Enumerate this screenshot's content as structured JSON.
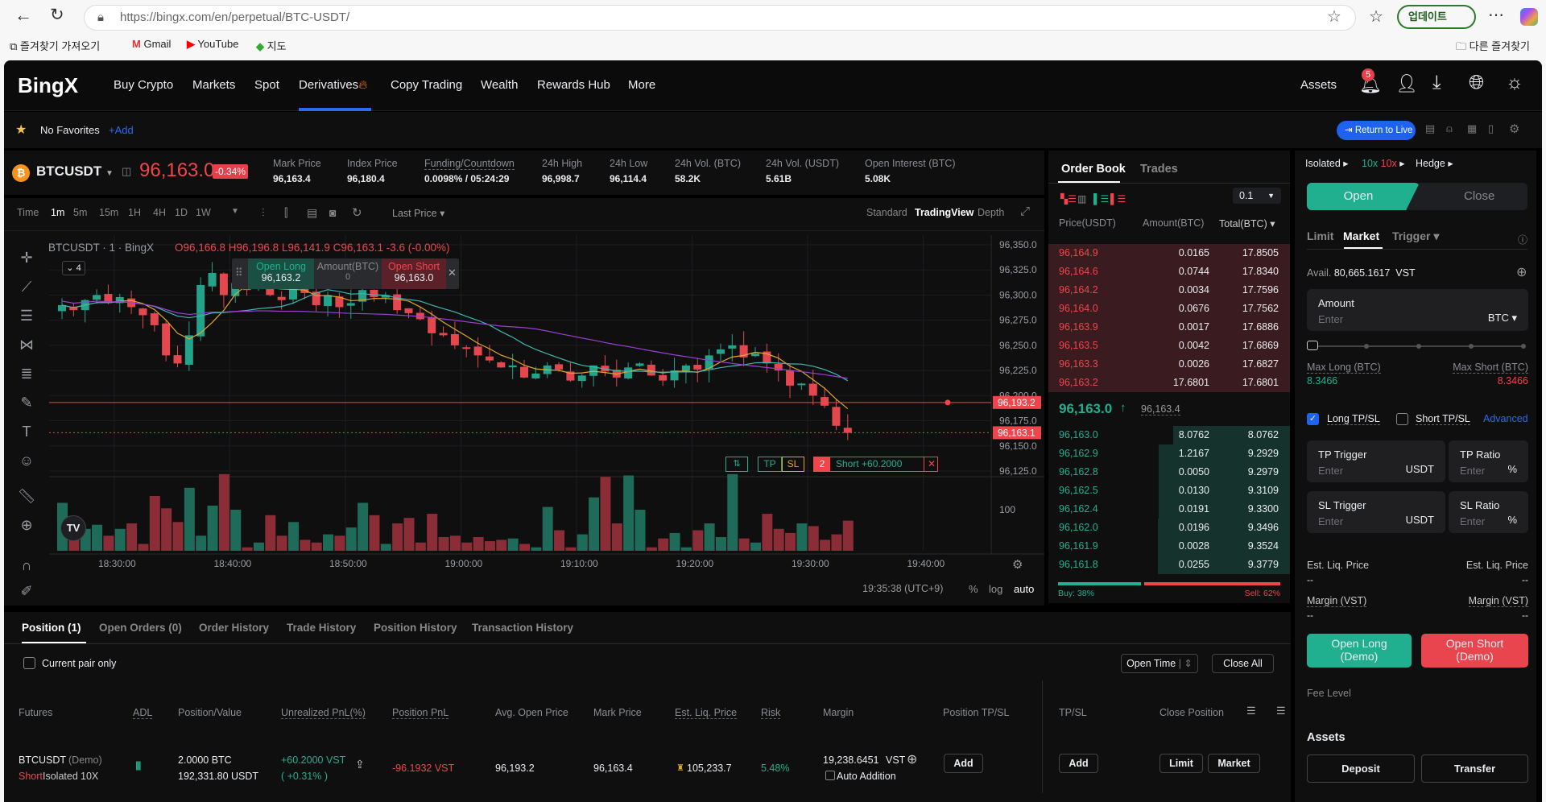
{
  "browser": {
    "url": "https://bingx.com/en/perpetual/BTC-USDT/",
    "update_label": "업데이트",
    "bookmarks": [
      "즐겨찾기 가져오기",
      "Gmail",
      "YouTube",
      "지도"
    ],
    "other_bookmarks": "다른 즐겨찾기"
  },
  "nav": {
    "logo": "BingX",
    "items": [
      "Buy Crypto",
      "Markets",
      "Spot",
      "Derivatives",
      "Copy Trading",
      "Wealth",
      "Rewards Hub",
      "More"
    ],
    "assets": "Assets",
    "notif_count": "5"
  },
  "favorites": {
    "label": "No Favorites",
    "add": "+Add",
    "return_live": "Return to Live"
  },
  "ticker": {
    "symbol": "BTCUSDT",
    "price": "96,163.0",
    "change": "-0.34%",
    "stats": [
      {
        "label": "Mark Price",
        "value": "96,163.4"
      },
      {
        "label": "Index Price",
        "value": "96,180.4"
      },
      {
        "label": "Funding/Countdown",
        "value": "0.0098% / 05:24:29"
      },
      {
        "label": "24h High",
        "value": "96,998.7"
      },
      {
        "label": "24h Low",
        "value": "96,114.4"
      },
      {
        "label": "24h Vol. (BTC)",
        "value": "58.2K"
      },
      {
        "label": "24h Vol. (USDT)",
        "value": "5.61B"
      },
      {
        "label": "Open Interest (BTC)",
        "value": "5.08K"
      }
    ]
  },
  "chart_toolbar": {
    "intervals": [
      "Time",
      "1m",
      "5m",
      "15m",
      "1H",
      "4H",
      "1D",
      "1W"
    ],
    "price_type": "Last Price",
    "views": [
      "Standard",
      "TradingView",
      "Depth"
    ]
  },
  "chart": {
    "legend_symbol": "BTCUSDT · 1 · BingX",
    "ohlc": "O96,166.8 H96,196.8 L96,141.9 C96,163.1 -3.6 (-0.00%)",
    "indicators_count": "4",
    "quick": {
      "open_long": "Open Long",
      "long_price": "96,163.2",
      "amount": "Amount(BTC)",
      "amount_val": "0",
      "open_short": "Open Short",
      "short_price": "96,163.0"
    },
    "position_line": {
      "tp": "TP",
      "sl": "SL",
      "qty": "2",
      "label": "Short +60.2000",
      "price": "96,193.2",
      "value": 96193.2
    },
    "last_price": {
      "label": "96,163.1",
      "value": 96163.1
    },
    "price_ticks": [
      "96,350.0",
      "96,325.0",
      "96,300.0",
      "96,275.0",
      "96,250.0",
      "96,225.0",
      "96,200.0",
      "96,175.0",
      "96,150.0",
      "96,125.0"
    ],
    "price_range": [
      96125,
      96350
    ],
    "time_ticks": [
      "18:30:00",
      "18:40:00",
      "18:50:00",
      "19:00:00",
      "19:10:00",
      "19:20:00",
      "19:30:00",
      "19:40:00"
    ],
    "volume_tick": "100",
    "closes": [
      96290,
      96285,
      96295,
      96300,
      96292,
      96298,
      96288,
      96280,
      96270,
      96240,
      96232,
      96260,
      96310,
      96322,
      96300,
      96312,
      96305,
      96318,
      96300,
      96295,
      96310,
      96302,
      96290,
      96300,
      96288,
      96292,
      96305,
      96298,
      96300,
      96285,
      96282,
      96276,
      96262,
      96260,
      96250,
      96248,
      96240,
      96235,
      96228,
      96230,
      96218,
      96222,
      96230,
      96226,
      96215,
      96220,
      96230,
      96224,
      96218,
      96228,
      96232,
      96220,
      96215,
      96225,
      96230,
      96226,
      96240,
      96246,
      96250,
      96238,
      96242,
      96232,
      96225,
      96210,
      96212,
      96200,
      96190,
      96170,
      96163
    ],
    "volumes": [
      70,
      22,
      32,
      38,
      22,
      32,
      40,
      10,
      80,
      62,
      42,
      92,
      22,
      66,
      112,
      60,
      5,
      12,
      52,
      22,
      42,
      16,
      12,
      24,
      22,
      34,
      70,
      52,
      10,
      40,
      48,
      12,
      54,
      20,
      22,
      12,
      20,
      14,
      16,
      18,
      10,
      5,
      64,
      30,
      5,
      24,
      78,
      108,
      40,
      110,
      60,
      5,
      18,
      26,
      5,
      30,
      40,
      20,
      112,
      18,
      12,
      54,
      32,
      26,
      40,
      36,
      16,
      24,
      44
    ],
    "timestamp": "19:35:38 (UTC+9)",
    "scale_opts": [
      "%",
      "log",
      "auto"
    ]
  },
  "orderbook": {
    "tabs": [
      "Order Book",
      "Trades"
    ],
    "precision": "0.1",
    "headers": [
      "Price(USDT)",
      "Amount(BTC)",
      "Total(BTC)"
    ],
    "asks": [
      [
        "96,164.9",
        "0.0165",
        "17.8505"
      ],
      [
        "96,164.6",
        "0.0744",
        "17.8340"
      ],
      [
        "96,164.2",
        "0.0034",
        "17.7596"
      ],
      [
        "96,164.0",
        "0.0676",
        "17.7562"
      ],
      [
        "96,163.9",
        "0.0017",
        "17.6886"
      ],
      [
        "96,163.5",
        "0.0042",
        "17.6869"
      ],
      [
        "96,163.3",
        "0.0026",
        "17.6827"
      ],
      [
        "96,163.2",
        "17.6801",
        "17.6801"
      ]
    ],
    "mid_price": "96,163.0",
    "mark": "96,163.4",
    "bids": [
      [
        "96,163.0",
        "8.0762",
        "8.0762"
      ],
      [
        "96,162.9",
        "1.2167",
        "9.2929"
      ],
      [
        "96,162.8",
        "0.0050",
        "9.2979"
      ],
      [
        "96,162.5",
        "0.0130",
        "9.3109"
      ],
      [
        "96,162.4",
        "0.0191",
        "9.3300"
      ],
      [
        "96,162.0",
        "0.0196",
        "9.3496"
      ],
      [
        "96,161.9",
        "0.0028",
        "9.3524"
      ],
      [
        "96,161.8",
        "0.0255",
        "9.3779"
      ]
    ],
    "buy_pct": 38,
    "buy_label": "Buy: 38%",
    "sell_label": "Sell: 62%"
  },
  "order": {
    "margin_mode": "Isolated",
    "lev_long": "10x",
    "lev_short": "10x",
    "mode": "Hedge",
    "open": "Open",
    "close": "Close",
    "types": [
      "Limit",
      "Market",
      "Trigger"
    ],
    "avail_label": "Avail.",
    "avail": "80,665.1617",
    "avail_unit": "VST",
    "amount_label": "Amount",
    "placeholder": "Enter",
    "amount_unit": "BTC",
    "max_long_label": "Max Long (BTC)",
    "max_long": "8.3466",
    "max_short_label": "Max Short (BTC)",
    "max_short": "8.3466",
    "long_tpsl": "Long TP/SL",
    "short_tpsl": "Short TP/SL",
    "advanced": "Advanced",
    "tp_trigger": "TP Trigger",
    "tp_ratio": "TP Ratio",
    "sl_trigger": "SL Trigger",
    "sl_ratio": "SL Ratio",
    "usdt": "USDT",
    "pct": "%",
    "est_liq": "Est. Liq. Price",
    "margin_vst": "Margin (VST)",
    "dash": "--",
    "open_long": "Open Long",
    "open_short": "Open Short",
    "demo": "(Demo)",
    "fee_level": "Fee Level",
    "assets": "Assets",
    "deposit": "Deposit",
    "transfer": "Transfer"
  },
  "positions": {
    "tabs": [
      "Position (1)",
      "Open Orders (0)",
      "Order History",
      "Trade History",
      "Position History",
      "Transaction History"
    ],
    "current_pair": "Current pair only",
    "open_time": "Open Time",
    "close_all": "Close All",
    "headers": [
      "Futures",
      "ADL",
      "Position/Value",
      "Unrealized PnL(%)",
      "Position PnL",
      "Avg. Open Price",
      "Mark Price",
      "Est. Liq. Price",
      "Risk",
      "Margin",
      "Position TP/SL",
      "TP/SL",
      "Close Position"
    ],
    "row": {
      "symbol": "BTCUSDT",
      "demo": "(Demo)",
      "side": "Short",
      "mode": "Isolated",
      "lev": "10X",
      "size": "2.0000 BTC",
      "value": "192,331.80 USDT",
      "upnl": "+60.2000 VST",
      "upnl_pct": "( +0.31% )",
      "ppnl": "-96.1932 VST",
      "avg": "96,193.2",
      "mark": "96,163.4",
      "liq": "105,233.7",
      "risk": "5.48%",
      "margin": "19,238.6451",
      "margin_unit": "VST",
      "auto_add": "Auto Addition",
      "add": "Add",
      "tpsl_add": "Add",
      "limit": "Limit",
      "market": "Market"
    }
  }
}
